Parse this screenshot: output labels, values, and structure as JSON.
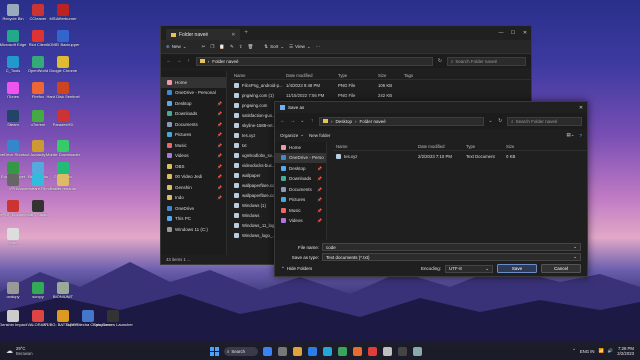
{
  "desktop": {
    "icons": [
      {
        "label": "Recycle Bin",
        "color": "#9ab"
      },
      {
        "label": "CCleaner",
        "color": "#c33"
      },
      {
        "label": "MSIAfterburner",
        "color": "#b22"
      },
      {
        "label": "Microsoft Edge",
        "color": "#2a8"
      },
      {
        "label": "Riot Client",
        "color": "#d33"
      },
      {
        "label": "AOMEI Backupper",
        "color": "#36c"
      },
      {
        "label": "C_Tools",
        "color": "#29c"
      },
      {
        "label": "OpenWorld",
        "color": "#3a7"
      },
      {
        "label": "Google Chrome",
        "color": "#db3"
      },
      {
        "label": "iTunes",
        "color": "#e5e"
      },
      {
        "label": "Firefox",
        "color": "#e63"
      },
      {
        "label": "Hard Disk Sentinel",
        "color": "#c42"
      },
      {
        "label": "Steam",
        "color": "#246"
      },
      {
        "label": "uTorrent",
        "color": "#4a4"
      },
      {
        "label": "ParadexHD",
        "color": "#c33"
      },
      {
        "label": "OneDrive Shortcut",
        "color": "#38c"
      },
      {
        "label": "Audacity",
        "color": "#c93"
      },
      {
        "label": "Mobile Downloader",
        "color": "#3c6"
      },
      {
        "label": "Edge Snippet",
        "color": "#394"
      },
      {
        "label": "BlueStacks",
        "color": "#5ad"
      },
      {
        "label": "GoodSync",
        "color": "#2b7"
      },
      {
        "label": "VPN",
        "color": "#666"
      },
      {
        "label": "Wondershare Filmora 12",
        "color": "#3bd"
      },
      {
        "label": "Folder rename",
        "color": "#db6"
      },
      {
        "label": "CutePDF Documents",
        "color": "#c33"
      },
      {
        "label": "OBS Studio",
        "color": "#333"
      },
      {
        "label": "code",
        "color": "#ddd"
      },
      {
        "label": "ondupy",
        "color": "#999"
      },
      {
        "label": "scrcpy",
        "color": "#3a5"
      },
      {
        "label": "BIONIUNIT",
        "color": "#9a9"
      },
      {
        "label": "Genshin Impact",
        "color": "#ccc"
      },
      {
        "label": "VALORANT",
        "color": "#d44"
      },
      {
        "label": "PUBG: BATTLEGR...",
        "color": "#d92"
      },
      {
        "label": "Super Mecha Champions",
        "color": "#47c"
      },
      {
        "label": "Epic Games Launcher",
        "color": "#333"
      }
    ]
  },
  "explorer": {
    "tab_title": "Folder naveé",
    "new_label": "New",
    "sort_label": "Sort",
    "view_label": "View",
    "address": "Folder naveé",
    "search_placeholder": "Search Folder naveé",
    "sidebar": [
      {
        "label": "Home",
        "active": true,
        "color": "#e9a"
      },
      {
        "label": "OneDrive - Personal",
        "active": false,
        "color": "#48c"
      },
      {
        "label": "Desktop",
        "active": false,
        "color": "#5ae"
      },
      {
        "label": "Downloads",
        "active": false,
        "color": "#4a9"
      },
      {
        "label": "Documents",
        "active": false,
        "color": "#89b"
      },
      {
        "label": "Pictures",
        "active": false,
        "color": "#4ad"
      },
      {
        "label": "Music",
        "active": false,
        "color": "#e66"
      },
      {
        "label": "Videos",
        "active": false,
        "color": "#a7d"
      },
      {
        "label": "OBS",
        "active": false,
        "color": "#db6"
      },
      {
        "label": "00 Video Jedi",
        "active": false,
        "color": "#db6"
      },
      {
        "label": "Genshin",
        "active": false,
        "color": "#db6"
      },
      {
        "label": "Indo",
        "active": false,
        "color": "#db6"
      },
      {
        "label": "OneDrive",
        "active": false,
        "color": "#48c"
      },
      {
        "label": "This PC",
        "active": false,
        "color": "#5ae"
      },
      {
        "label": "Windows 11 (C:)",
        "active": false,
        "color": "#999"
      }
    ],
    "columns": [
      "Name",
      "Date modified",
      "Type",
      "Size",
      "Tags"
    ],
    "files": [
      {
        "name": "FilcsPng_android-p...",
        "date": "1/4/2023 9:48 PM",
        "type": "PNG File",
        "size": "106 KB"
      },
      {
        "name": "pngwing.com (1)",
        "date": "11/15/2022 7:56 PM",
        "type": "PNG File",
        "size": "242 KB"
      },
      {
        "name": "pngwing.com",
        "date": "",
        "type": "",
        "size": ""
      },
      {
        "name": "satisfaction-guo...",
        "date": "",
        "type": "",
        "size": ""
      },
      {
        "name": "skyline-1588-ret...",
        "date": "",
        "type": "",
        "size": ""
      },
      {
        "name": "tes.xyz",
        "date": "",
        "type": "",
        "size": ""
      },
      {
        "name": "txt",
        "date": "",
        "type": "",
        "size": ""
      },
      {
        "name": "ugmkodlobx_sv...",
        "date": "",
        "type": "",
        "size": ""
      },
      {
        "name": "videodocks-buc...",
        "date": "",
        "type": "",
        "size": ""
      },
      {
        "name": "wallpaper",
        "date": "",
        "type": "",
        "size": ""
      },
      {
        "name": "wallpaperflare.co...",
        "date": "",
        "type": "",
        "size": ""
      },
      {
        "name": "wallpaperflare.co...",
        "date": "",
        "type": "",
        "size": ""
      },
      {
        "name": "Windows (1)",
        "date": "",
        "type": "",
        "size": ""
      },
      {
        "name": "Windows",
        "date": "",
        "type": "",
        "size": ""
      },
      {
        "name": "Windows_11_log...",
        "date": "",
        "type": "",
        "size": ""
      },
      {
        "name": "Windows_logo_...",
        "date": "",
        "type": "",
        "size": ""
      }
    ],
    "status": "43 items   1 ..."
  },
  "saveas": {
    "title": "Save as",
    "address_parts": [
      "Desktop",
      "Folder naveé"
    ],
    "search_placeholder": "Search Folder naveé",
    "organize_label": "Organize",
    "new_folder_label": "New folder",
    "sidebar": [
      {
        "label": "Home",
        "active": false,
        "color": "#e9a"
      },
      {
        "label": "OneDrive - Perso",
        "active": true,
        "color": "#48c"
      },
      {
        "label": "Desktop",
        "active": false,
        "color": "#5ae"
      },
      {
        "label": "Downloads",
        "active": false,
        "color": "#4a9"
      },
      {
        "label": "Documents",
        "active": false,
        "color": "#89b"
      },
      {
        "label": "Pictures",
        "active": false,
        "color": "#4ad"
      },
      {
        "label": "Music",
        "active": false,
        "color": "#e66"
      },
      {
        "label": "Videos",
        "active": false,
        "color": "#a7d"
      }
    ],
    "columns": [
      "Name",
      "Date modified",
      "Type",
      "Size"
    ],
    "files": [
      {
        "name": "tes.xyz",
        "date": "2/2/2023 7:10 PM",
        "type": "Text Document",
        "size": "0 KB"
      }
    ],
    "file_name_label": "File name:",
    "file_name_value": "code",
    "save_type_label": "Save as type:",
    "save_type_value": "Text documents (*.txt)",
    "hide_folders_label": "Hide Folders",
    "encoding_label": "Encoding:",
    "encoding_value": "UTF-8",
    "save_label": "Save",
    "cancel_label": "Cancel"
  },
  "taskbar": {
    "weather_temp": "29°C",
    "weather_text": "Berawan",
    "search_label": "Search",
    "lang": "ENG IN",
    "time": "7:28 PM",
    "date": "2/2/2023",
    "apps": [
      "#3b82f6",
      "#777",
      "#e2a23b",
      "#2b7de9",
      "#27a4d8",
      "#3ba55d",
      "#e86b2f",
      "#e23d3d",
      "#c0c0c0",
      "#444",
      "#8aa"
    ]
  }
}
